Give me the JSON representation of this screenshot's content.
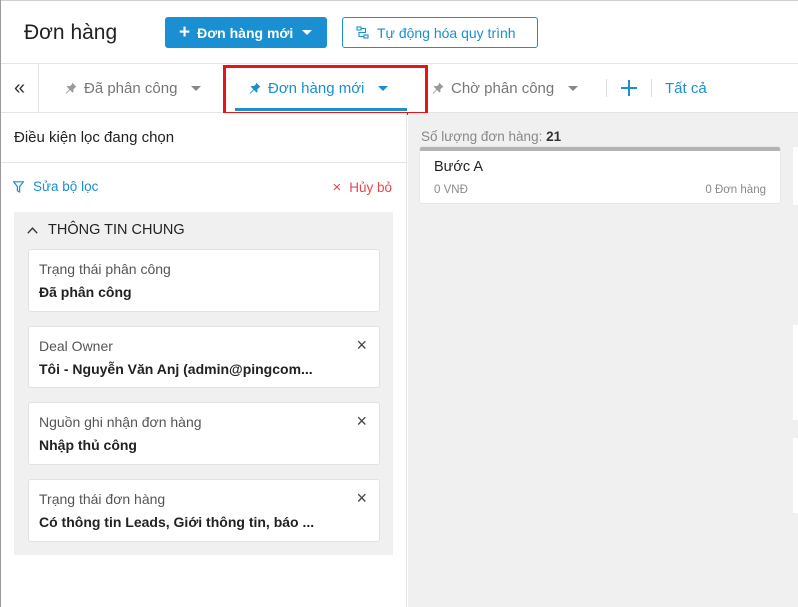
{
  "header": {
    "title": "Đơn hàng",
    "new_order_label": "Đơn hàng mới",
    "automation_label": "Tự động hóa quy trình"
  },
  "tabs": {
    "collapse_glyph": "«",
    "items": [
      {
        "label": "Đã phân công",
        "icon": "pin-icon",
        "active": false
      },
      {
        "label": "Đơn hàng mới",
        "icon": "pin-icon",
        "active": true
      },
      {
        "label": "Chờ phân công",
        "icon": "pin-icon",
        "active": false
      }
    ],
    "all_label": "Tất cả"
  },
  "filter": {
    "header": "Điều kiện lọc đang chọn",
    "edit_label": "Sửa bộ lọc",
    "cancel_label": "Hủy bỏ",
    "group_title": "THÔNG TIN CHUNG",
    "cards": [
      {
        "label": "Trạng thái phân công",
        "value": "Đã phân công",
        "removable": false
      },
      {
        "label": "Deal Owner",
        "value": "Tôi - Nguyễn Văn Anj (admin@pingcom...",
        "removable": true
      },
      {
        "label": "Nguồn ghi nhận đơn hàng",
        "value": "Nhập thủ công",
        "removable": true
      },
      {
        "label": "Trạng thái đơn hàng",
        "value": "Có thông tin Leads, Giới thông tin, báo ...",
        "removable": true
      }
    ]
  },
  "board": {
    "count_label": "Số lượng đơn hàng:",
    "count_value": "21",
    "columns": [
      {
        "name": "Bước A",
        "amount": "0 VNĐ",
        "orders": "0 Đơn hàng"
      }
    ]
  },
  "colors": {
    "accent": "#1a8fd1",
    "highlight": "#e8141a",
    "danger": "#e5484d"
  }
}
